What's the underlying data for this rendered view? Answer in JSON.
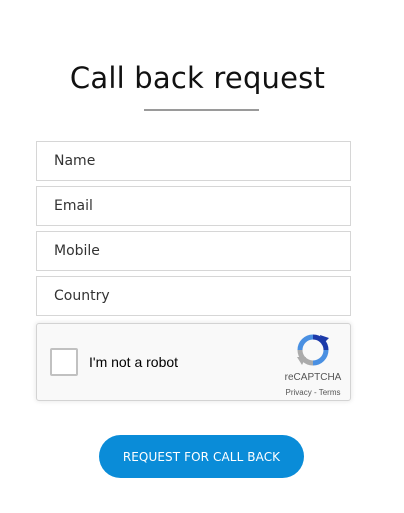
{
  "form": {
    "title": "Call back request",
    "fields": {
      "name_placeholder": "Name",
      "email_placeholder": "Email",
      "mobile_placeholder": "Mobile",
      "country_placeholder": "Country"
    },
    "submit_label": "REQUEST FOR CALL BACK",
    "accent_color": "#0a8cd8"
  },
  "recaptcha": {
    "checkbox_label": "I'm not a robot",
    "brand": "reCAPTCHA",
    "privacy_label": "Privacy",
    "separator": " - ",
    "terms_label": "Terms",
    "checked": false,
    "logo_icon": "recaptcha-logo-icon"
  }
}
